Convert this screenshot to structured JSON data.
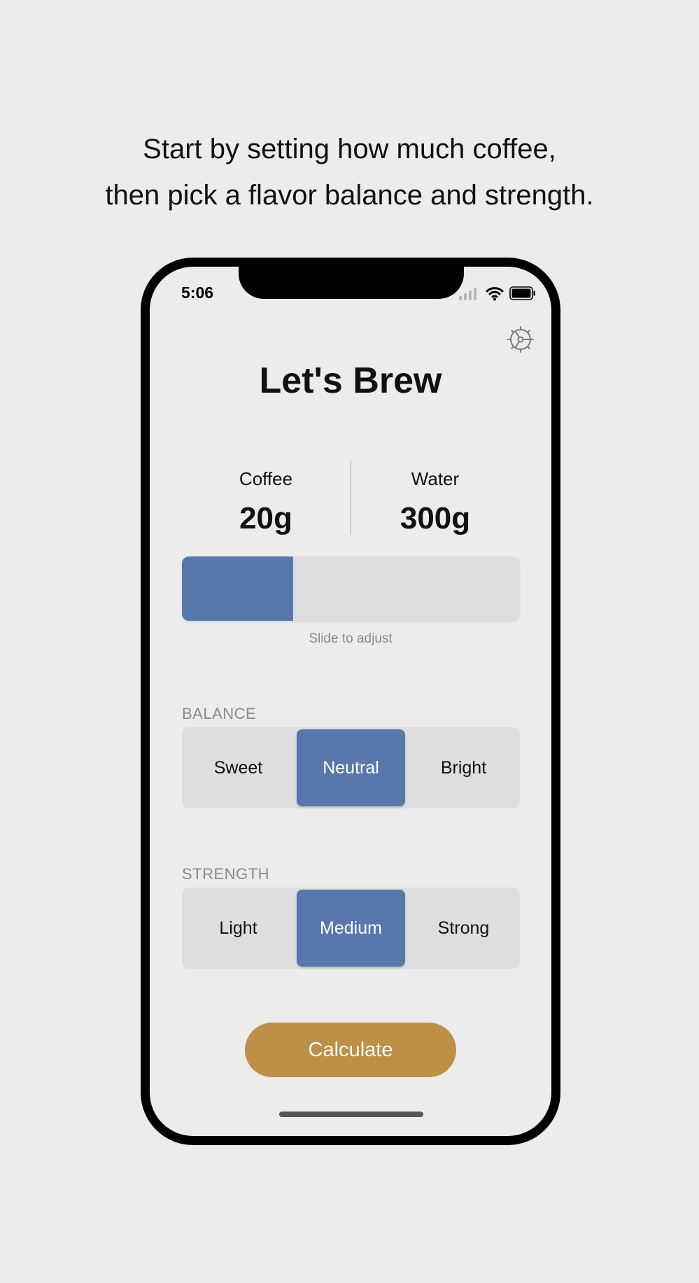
{
  "caption": {
    "line1": "Start by setting how much coffee,",
    "line2": "then pick a flavor balance and strength."
  },
  "status_bar": {
    "time": "5:06",
    "icons": [
      "signal-icon",
      "wifi-icon",
      "battery-icon"
    ]
  },
  "header": {
    "title": "Let's Brew",
    "settings_icon": "gear-icon"
  },
  "amounts": {
    "coffee": {
      "label": "Coffee",
      "value": "20g"
    },
    "water": {
      "label": "Water",
      "value": "300g"
    }
  },
  "slider": {
    "fraction": 0.33,
    "hint": "Slide to adjust"
  },
  "balance": {
    "label": "BALANCE",
    "options": [
      "Sweet",
      "Neutral",
      "Bright"
    ],
    "selected": "Neutral"
  },
  "strength": {
    "label": "STRENGTH",
    "options": [
      "Light",
      "Medium",
      "Strong"
    ],
    "selected": "Medium"
  },
  "calculate_button": {
    "label": "Calculate"
  },
  "colors": {
    "accent": "#5878ad",
    "button": "#bd8f47",
    "background": "#ececec",
    "control_bg": "#dedede"
  }
}
